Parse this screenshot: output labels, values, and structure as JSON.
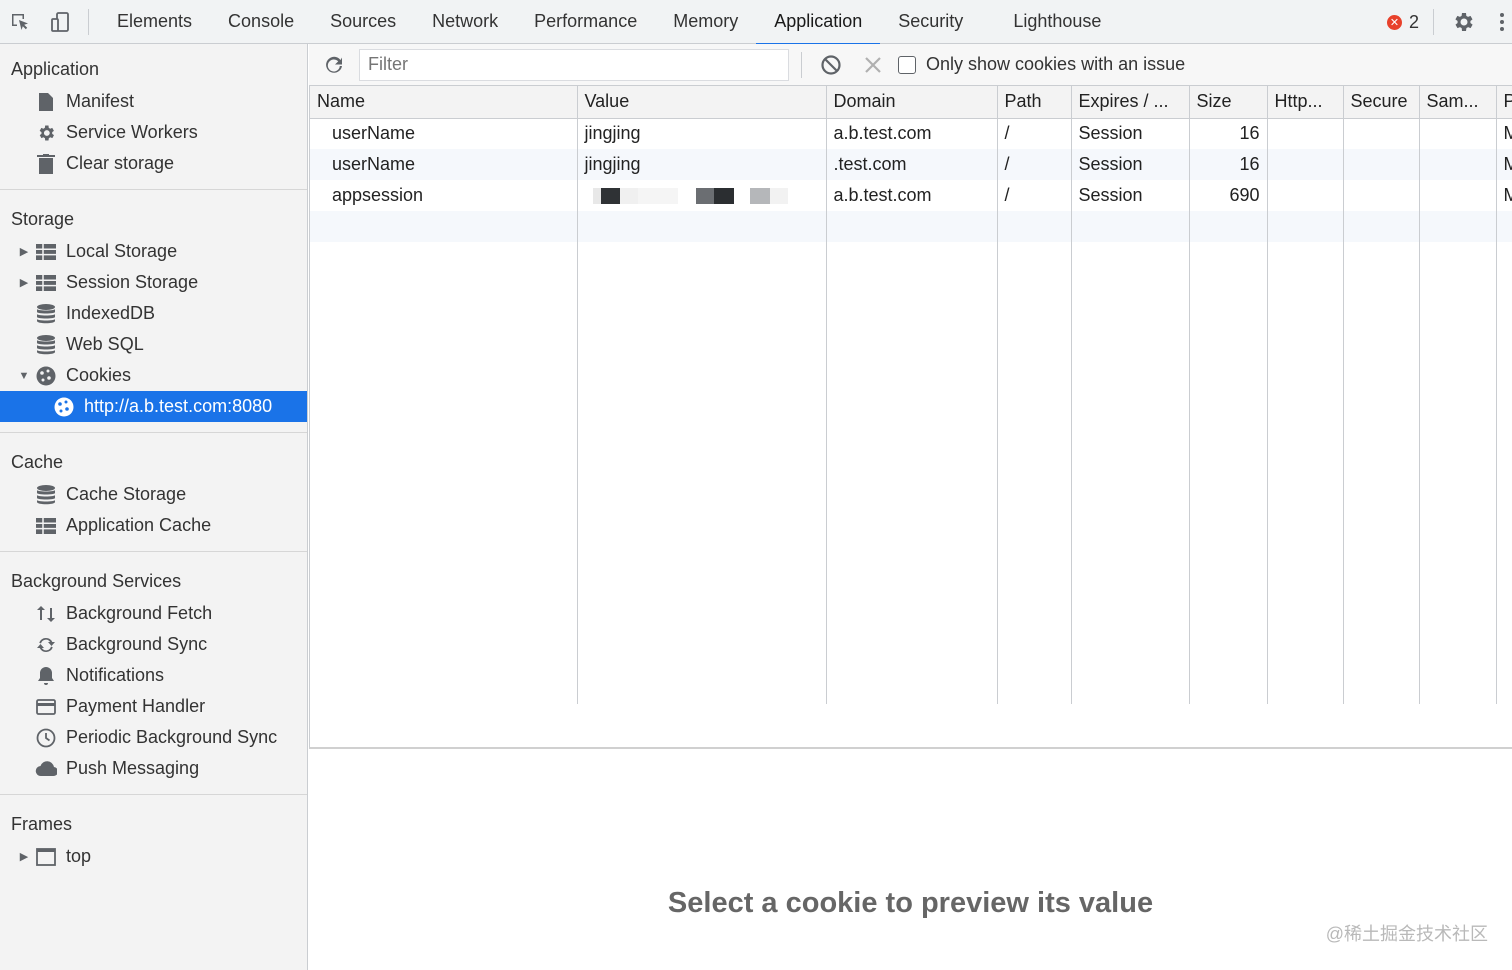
{
  "toolbar": {
    "tabs": [
      "Elements",
      "Console",
      "Sources",
      "Network",
      "Performance",
      "Memory",
      "Application",
      "Security",
      "Lighthouse"
    ],
    "active_tab": "Application",
    "error_count": "2",
    "accent": "#1a73e8"
  },
  "sidebar": {
    "application": {
      "title": "Application",
      "items": [
        "Manifest",
        "Service Workers",
        "Clear storage"
      ]
    },
    "storage": {
      "title": "Storage",
      "items": [
        "Local Storage",
        "Session Storage",
        "IndexedDB",
        "Web SQL",
        "Cookies"
      ],
      "cookie_origin": "http://a.b.test.com:8080"
    },
    "cache": {
      "title": "Cache",
      "items": [
        "Cache Storage",
        "Application Cache"
      ]
    },
    "background": {
      "title": "Background Services",
      "items": [
        "Background Fetch",
        "Background Sync",
        "Notifications",
        "Payment Handler",
        "Periodic Background Sync",
        "Push Messaging"
      ]
    },
    "frames": {
      "title": "Frames",
      "items": [
        "top"
      ]
    }
  },
  "filter": {
    "placeholder": "Filter",
    "only_issues_label": "Only show cookies with an issue"
  },
  "table": {
    "columns": [
      "Name",
      "Value",
      "Domain",
      "Path",
      "Expires / ...",
      "Size",
      "Http...",
      "Secure",
      "Sam...",
      "P"
    ],
    "rows": [
      {
        "name": "userName",
        "value": "jingjing",
        "domain": "a.b.test.com",
        "path": "/",
        "expires": "Session",
        "size": "16",
        "http": "",
        "secure": "",
        "same": "",
        "p": "M"
      },
      {
        "name": "userName",
        "value": "jingjing",
        "domain": ".test.com",
        "path": "/",
        "expires": "Session",
        "size": "16",
        "http": "",
        "secure": "",
        "same": "",
        "p": "M"
      },
      {
        "name": "appsession",
        "value": "",
        "domain": "a.b.test.com",
        "path": "/",
        "expires": "Session",
        "size": "690",
        "http": "",
        "secure": "",
        "same": "",
        "p": "M"
      }
    ]
  },
  "preview": {
    "message": "Select a cookie to preview its value"
  },
  "watermark": "@稀土掘金技术社区"
}
